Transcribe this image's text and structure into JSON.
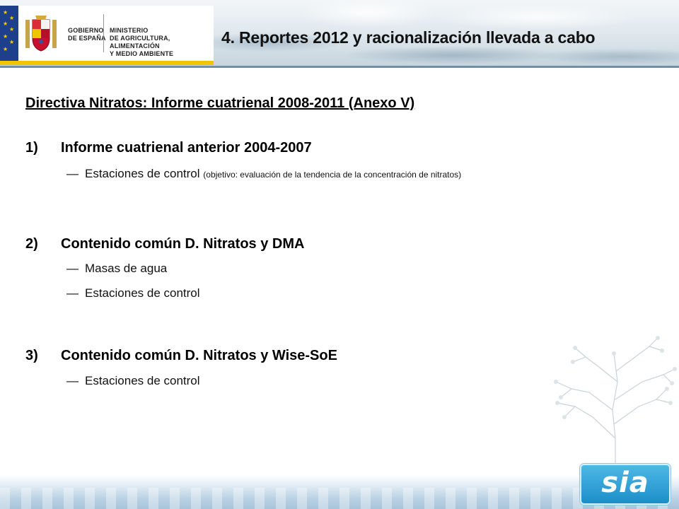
{
  "header": {
    "title": "4. Reportes 2012 y racionalización llevada a cabo",
    "logo": {
      "gobierno_line1": "GOBIERNO",
      "gobierno_line2": "DE ESPAÑA",
      "ministerio_line1": "MINISTERIO",
      "ministerio_line2": "DE AGRICULTURA, ALIMENTACIÓN",
      "ministerio_line3": "Y MEDIO AMBIENTE"
    }
  },
  "content": {
    "section_title": "Directiva Nitratos: Informe cuatrienal 2008-2011 (Anexo V)",
    "items": [
      {
        "number": "1)",
        "heading": "Informe cuatrienal anterior 2004-2007",
        "subitems": [
          {
            "dash": "—",
            "text": "Estaciones de control",
            "note": "(objetivo: evaluación de la tendencia de la concentración de nitratos)"
          }
        ]
      },
      {
        "number": "2)",
        "heading": "Contenido común D. Nitratos y DMA",
        "subitems": [
          {
            "dash": "—",
            "text": "Masas de agua"
          },
          {
            "dash": "—",
            "text": "Estaciones de control"
          }
        ]
      },
      {
        "number": "3)",
        "heading": "Contenido común D. Nitratos y Wise-SoE",
        "subitems": [
          {
            "dash": "—",
            "text": "Estaciones de control"
          }
        ]
      }
    ]
  },
  "footer": {
    "brand_logo_text": "sia",
    "icons": [
      "eu-flag-icon",
      "spain-crest-icon",
      "tree-illustration",
      "sia-logo"
    ]
  },
  "colors": {
    "flag_blue": "#1d3f8c",
    "flag_yellow": "#f7d000",
    "logo_underline": "#f1c400",
    "sia_blue": "#1b8fc9"
  }
}
